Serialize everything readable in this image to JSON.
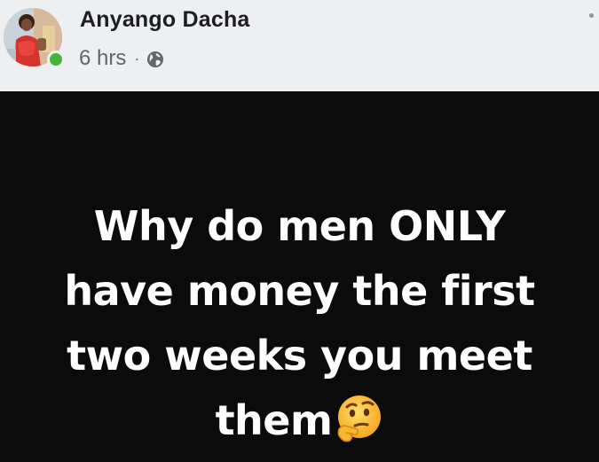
{
  "post": {
    "author": "Anyango Dacha",
    "time": "6 hrs",
    "separator": "·",
    "privacy_icon": "globe-icon",
    "author_online": true,
    "more_icon": "more-dot-icon",
    "text_lines": [
      "Why do men ONLY",
      "have money the first",
      "two weeks you meet",
      "them"
    ],
    "emoji": "thinking-face-emoji",
    "colors": {
      "header_bg": "#eeeff1",
      "body_bg": "#0b0b0b",
      "text": "#ffffff",
      "online": "#44b440"
    }
  }
}
